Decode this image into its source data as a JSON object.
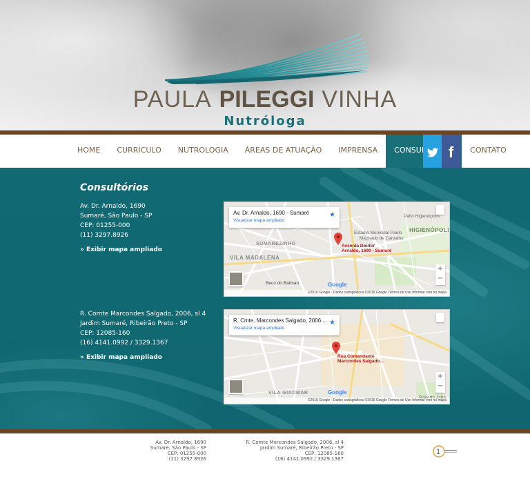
{
  "header": {
    "logo_first": "PAULA",
    "logo_middle": "PILEGGI",
    "logo_last": "VINHA",
    "logo_subtitle": "Nutróloga"
  },
  "nav": {
    "items": [
      {
        "label": "HOME"
      },
      {
        "label": "CURRÍCULO"
      },
      {
        "label": "NUTROLOGIA"
      },
      {
        "label": "ÁREAS DE ATUAÇÃO"
      },
      {
        "label": "IMPRENSA"
      },
      {
        "label": "CONSULTÓRIOS"
      },
      {
        "label": "CONTATO"
      }
    ],
    "active_label": "CONSULTÓRIOS",
    "social": {
      "twitter_icon": "twitter-icon",
      "facebook_glyph": "f"
    }
  },
  "main": {
    "title": "Consultórios",
    "offices": [
      {
        "line1": "Av. Dr. Arnaldo, 1690",
        "line2": "Sumaré, São Paulo - SP",
        "line3": "CEP: 01255-000",
        "line4": "(11) 3297.8926",
        "link": "» Exibir mapa ampliado",
        "map": {
          "card_title": "Av. Dr. Arnaldo, 1690 - Sumaré",
          "card_link": "Visualizar mapa ampliado",
          "pin_label_1": "Avenida Doutor",
          "pin_label_2": "Arnaldo, 1690 - Sumaré",
          "labels": {
            "patio": "Pátio Higienópolis",
            "higienopolis": "HIGIENÓPOLIS",
            "estadio_1": "Estadio Municipal Paulo",
            "estadio_2": "Machado de Carvalho",
            "sumarezinho": "SUMAREZINHO",
            "madalena": "VILA MADALENA",
            "batman": "Beco do Batman"
          },
          "google": "Google",
          "footer": "©2016 Google - Dados cartográficos ©2016 Google   Termos de Uso   Informar erro no mapa"
        }
      },
      {
        "line1": "R. Comte Marcondes Salgado, 2006, sl 4",
        "line2": "Jardim Sumaré, Ribeirão Preto - SP",
        "line3": "CEP: 12085-160",
        "line4": "(16) 4141.0992 / 3329.1367",
        "link": "» Exibir mapa ampliado",
        "map": {
          "card_title": "R. Cmte. Marcondes Salgado, 2006 ...",
          "card_link": "Visualizar mapa ampliado",
          "pin_label_1": "Rua Comandante",
          "pin_label_2": "Marcondes Salgado...",
          "labels": {
            "guiomar": "VILA GUIOMAR",
            "jabu": "Roberto Jabá"
          },
          "google": "Google",
          "footer": "©2016 Google - Dados cartográficos ©2016 Google   Termos de Uso   Informar erro no mapa"
        }
      }
    ]
  },
  "footer": {
    "office1": [
      "Av. Dr. Arnaldo, 1690",
      "Sumaré, São Paulo - SP",
      "CEP: 01255-000",
      "(11) 3297.8926"
    ],
    "office2": [
      "R. Comte Marcondes Salgado, 2006, sl 4",
      "Jardim Sumaré, Ribeirão Preto - SP",
      "CEP: 12085-160",
      "(16) 4141.0992 / 3329.1367"
    ]
  },
  "colors": {
    "brown": "#6b4424",
    "teal": "#116a73",
    "nav_text": "#7a6148",
    "twitter": "#27a2e0",
    "facebook": "#3f5b97"
  }
}
